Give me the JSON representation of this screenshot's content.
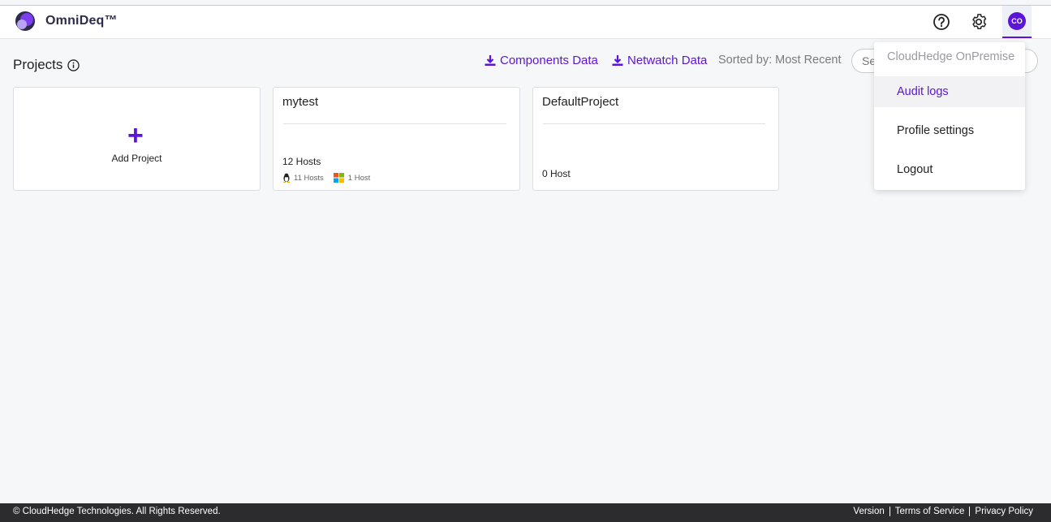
{
  "header": {
    "brand": "OmniDeq™",
    "avatar_initials": "CO"
  },
  "projects": {
    "title": "Projects",
    "components_data_label": "Components Data",
    "netwatch_data_label": "Netwatch Data",
    "sorted_by": "Sorted by: Most Recent",
    "search_placeholder": "Se",
    "add_project_label": "Add Project",
    "cards": [
      {
        "name": "mytest",
        "hosts": "12 Hosts",
        "linux_hosts": "11 Hosts",
        "windows_hosts": "1 Host"
      },
      {
        "name": "DefaultProject",
        "hosts": "0 Host"
      }
    ]
  },
  "user_menu": {
    "org_name": "CloudHedge OnPremise",
    "items": [
      "Audit logs",
      "Profile settings",
      "Logout"
    ]
  },
  "footer": {
    "copyright": "© CloudHedge Technologies. All Rights Reserved.",
    "links": [
      "Version",
      "Terms of Service",
      "Privacy Policy"
    ]
  },
  "colors": {
    "accent": "#5b14d8",
    "footer_bg": "#2c2c2e",
    "page_bg": "#f6f7f9"
  }
}
